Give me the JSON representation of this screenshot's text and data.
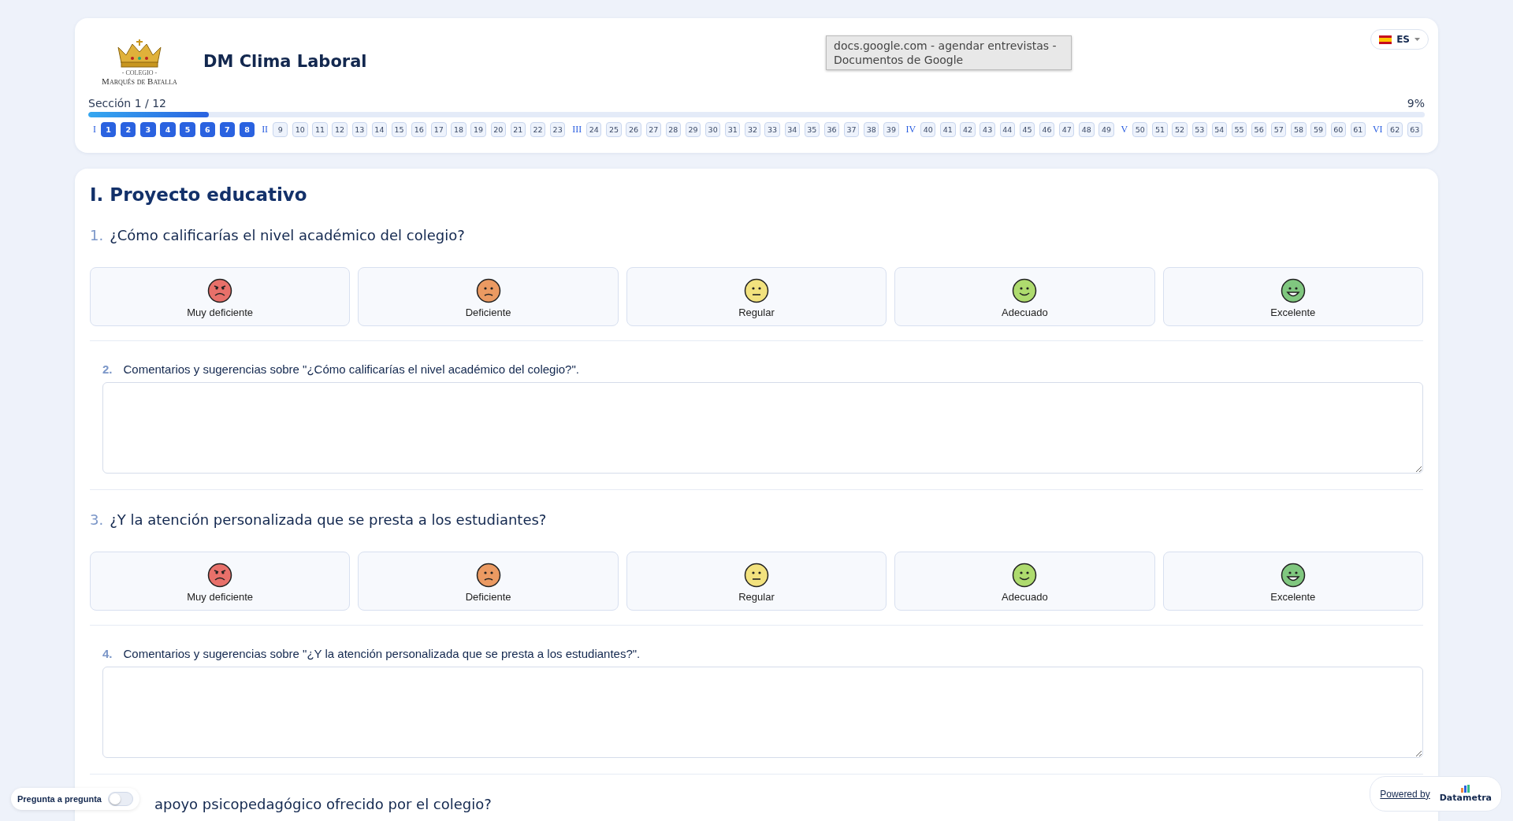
{
  "header": {
    "logo": {
      "small_text": "- COLEGIO -",
      "name": "Marqués de Batalla"
    },
    "title": "DM Clima Laboral",
    "language": {
      "code": "ES"
    },
    "tooltip": "docs.google.com - agendar entrevistas - Documentos de Google"
  },
  "progress": {
    "section_label": "Sección 1 / 12",
    "percent": "9%",
    "level": 0.09
  },
  "sections_nav": [
    {
      "label": "I",
      "questions": [
        {
          "number": "1",
          "answered": true
        },
        {
          "number": "2",
          "answered": true
        },
        {
          "number": "3",
          "answered": true
        },
        {
          "number": "4",
          "answered": true
        },
        {
          "number": "5",
          "answered": true
        },
        {
          "number": "6",
          "answered": true
        },
        {
          "number": "7",
          "answered": true
        },
        {
          "number": "8",
          "answered": true
        }
      ]
    },
    {
      "label": "II",
      "questions": [
        {
          "number": "9",
          "answered": false
        },
        {
          "number": "10",
          "answered": false
        },
        {
          "number": "11",
          "answered": false
        },
        {
          "number": "12",
          "answered": false
        },
        {
          "number": "13",
          "answered": false
        },
        {
          "number": "14",
          "answered": false
        },
        {
          "number": "15",
          "answered": false
        },
        {
          "number": "16",
          "answered": false
        },
        {
          "number": "17",
          "answered": false
        },
        {
          "number": "18",
          "answered": false
        },
        {
          "number": "19",
          "answered": false
        },
        {
          "number": "20",
          "answered": false
        },
        {
          "number": "21",
          "answered": false
        },
        {
          "number": "22",
          "answered": false
        },
        {
          "number": "23",
          "answered": false
        }
      ]
    },
    {
      "label": "III",
      "questions": [
        {
          "number": "24",
          "answered": false
        },
        {
          "number": "25",
          "answered": false
        },
        {
          "number": "26",
          "answered": false
        },
        {
          "number": "27",
          "answered": false
        },
        {
          "number": "28",
          "answered": false
        },
        {
          "number": "29",
          "answered": false
        },
        {
          "number": "30",
          "answered": false
        },
        {
          "number": "31",
          "answered": false
        },
        {
          "number": "32",
          "answered": false
        },
        {
          "number": "33",
          "answered": false
        },
        {
          "number": "34",
          "answered": false
        },
        {
          "number": "35",
          "answered": false
        },
        {
          "number": "36",
          "answered": false
        },
        {
          "number": "37",
          "answered": false
        },
        {
          "number": "38",
          "answered": false
        },
        {
          "number": "39",
          "answered": false
        }
      ]
    },
    {
      "label": "IV",
      "questions": [
        {
          "number": "40",
          "answered": false
        },
        {
          "number": "41",
          "answered": false
        },
        {
          "number": "42",
          "answered": false
        },
        {
          "number": "43",
          "answered": false
        },
        {
          "number": "44",
          "answered": false
        },
        {
          "number": "45",
          "answered": false
        },
        {
          "number": "46",
          "answered": false
        },
        {
          "number": "47",
          "answered": false
        },
        {
          "number": "48",
          "answered": false
        },
        {
          "number": "49",
          "answered": false
        }
      ]
    },
    {
      "label": "V",
      "questions": [
        {
          "number": "50",
          "answered": false
        },
        {
          "number": "51",
          "answered": false
        },
        {
          "number": "52",
          "answered": false
        },
        {
          "number": "53",
          "answered": false
        },
        {
          "number": "54",
          "answered": false
        },
        {
          "number": "55",
          "answered": false
        },
        {
          "number": "56",
          "answered": false
        },
        {
          "number": "57",
          "answered": false
        },
        {
          "number": "58",
          "answered": false
        },
        {
          "number": "59",
          "answered": false
        },
        {
          "number": "60",
          "answered": false
        },
        {
          "number": "61",
          "answered": false
        }
      ]
    },
    {
      "label": "VI",
      "questions": [
        {
          "number": "62",
          "answered": false
        },
        {
          "number": "63",
          "answered": false
        }
      ]
    }
  ],
  "section": {
    "title": "I. Proyecto educativo",
    "questions": [
      {
        "kind": "rating",
        "number": "1.",
        "text": "¿Cómo calificarías el nivel académico del colegio?",
        "options": [
          {
            "kind": "very-bad",
            "label": "Muy deficiente",
            "color": "#e8706a"
          },
          {
            "kind": "bad",
            "label": "Deficiente",
            "color": "#eb9a62"
          },
          {
            "kind": "neutral",
            "label": "Regular",
            "color": "#f2e27e"
          },
          {
            "kind": "good",
            "label": "Adecuado",
            "color": "#aedb6e"
          },
          {
            "kind": "excellent",
            "label": "Excelente",
            "color": "#80c77f"
          }
        ]
      },
      {
        "kind": "comment",
        "number": "2.",
        "text": "Comentarios y sugerencias sobre \"¿Cómo calificarías el nivel académico del colegio?\"."
      },
      {
        "kind": "rating",
        "number": "3.",
        "text": "¿Y la atención personalizada que se presta a los estudiantes?",
        "options": [
          {
            "kind": "very-bad",
            "label": "Muy deficiente",
            "color": "#e8706a"
          },
          {
            "kind": "bad",
            "label": "Deficiente",
            "color": "#eb9a62"
          },
          {
            "kind": "neutral",
            "label": "Regular",
            "color": "#f2e27e"
          },
          {
            "kind": "good",
            "label": "Adecuado",
            "color": "#aedb6e"
          },
          {
            "kind": "excellent",
            "label": "Excelente",
            "color": "#80c77f"
          }
        ]
      },
      {
        "kind": "comment",
        "number": "4.",
        "text": "Comentarios y sugerencias sobre \"¿Y la atención personalizada que se presta a los estudiantes?\"."
      },
      {
        "kind": "rating",
        "text": "apoyo psicopedagógico ofrecido por el colegio?"
      }
    ]
  },
  "footer": {
    "mode_toggle": {
      "label": "Pregunta a pregunta",
      "on": false
    },
    "powered_by": "Powered by",
    "brand": "Datametra"
  }
}
